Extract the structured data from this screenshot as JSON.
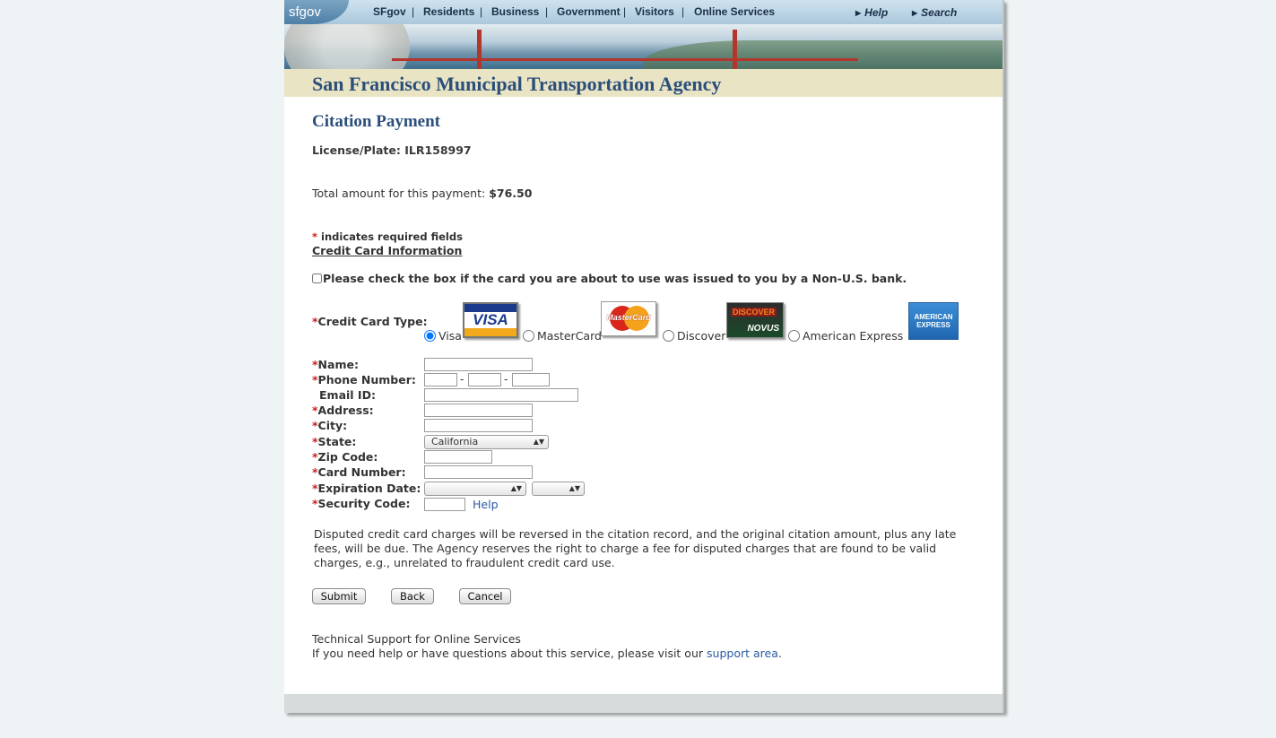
{
  "header": {
    "logo": "sfgov",
    "nav": [
      "SFgov",
      "Residents",
      "Business",
      "Government",
      "Visitors",
      "Online Services"
    ],
    "nav_separator": "|",
    "help": "Help",
    "search": "Search",
    "agency_title": "San Francisco Municipal Transportation Agency"
  },
  "page": {
    "title": "Citation Payment",
    "plate": "License/Plate: ILR158997",
    "total_label": "Total amount for this payment:",
    "total_value": "$76.50",
    "required_marker": "*",
    "required_note": "indicates required fields",
    "cc_heading": "Credit Card Information",
    "nonus_text": "Please check the box if the card you are about to use was issued to you by a Non-U.S. bank."
  },
  "card_type": {
    "label": "Credit Card Type:",
    "options": [
      "Visa",
      "MasterCard",
      "Discover",
      "American Express"
    ],
    "selected": "Visa",
    "images": {
      "visa": "VISA",
      "mastercard": "MasterCard",
      "discover_top": "DISCOVER",
      "discover_bottom": "NOVUS",
      "amex": "AMERICAN EXPRESS"
    }
  },
  "form": {
    "name_label": "Name:",
    "phone_label": "Phone Number:",
    "phone_dash": "-",
    "email_label": "Email ID:",
    "address_label": "Address:",
    "city_label": "City:",
    "state_label": "State:",
    "state_value": "California",
    "zip_label": "Zip Code:",
    "card_number_label": "Card Number:",
    "expiration_label": "Expiration Date:",
    "expiration_month": "",
    "expiration_year": "",
    "security_label": "Security Code:",
    "security_help": "Help"
  },
  "disclaimer": "Disputed credit card charges will be reversed in the citation record, and the original citation amount, plus any late fees, will be due. The Agency reserves the right to charge a fee for disputed charges that are found to be valid charges, e.g., unrelated to fraudulent credit card use.",
  "buttons": {
    "submit": "Submit",
    "back": "Back",
    "cancel": "Cancel"
  },
  "support": {
    "title": "Technical Support for Online Services",
    "text": "If you need help or have questions about this service, please visit our",
    "link": "support area",
    "period": "."
  },
  "colors": {
    "background": "#eef4f5",
    "title_blue": "#2b4e7a",
    "required_red": "#c81e1e",
    "link_blue": "#2b5aa0",
    "agency_bar": "#e8e4c4"
  }
}
